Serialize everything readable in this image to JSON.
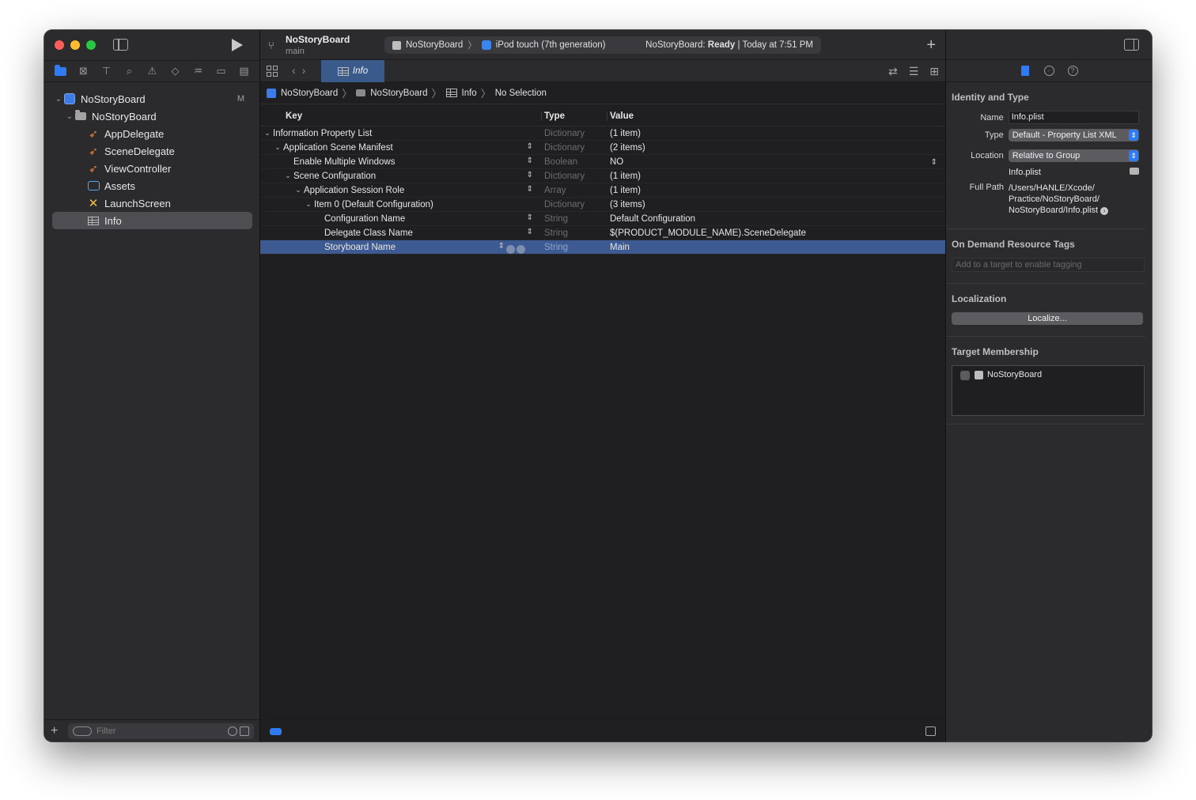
{
  "navigator": {
    "tree": [
      {
        "label": "NoStoryBoard",
        "kind": "project",
        "badge": "M"
      },
      {
        "label": "NoStoryBoard",
        "kind": "group"
      },
      {
        "label": "AppDelegate",
        "kind": "swift"
      },
      {
        "label": "SceneDelegate",
        "kind": "swift"
      },
      {
        "label": "ViewController",
        "kind": "swift"
      },
      {
        "label": "Assets",
        "kind": "assets"
      },
      {
        "label": "LaunchScreen",
        "kind": "storyboard"
      },
      {
        "label": "Info",
        "kind": "plist",
        "selected": true
      }
    ],
    "filter_placeholder": "Filter"
  },
  "toolbar": {
    "project": "NoStoryBoard",
    "branch": "main",
    "scheme": "NoStoryBoard",
    "device": "iPod touch (7th generation)",
    "status_prefix": "NoStoryBoard: ",
    "status_bold": "Ready",
    "status_suffix": " | Today at 7:51 PM"
  },
  "tab": {
    "label": "Info"
  },
  "jumpbar": {
    "items": [
      "NoStoryBoard",
      "NoStoryBoard",
      "Info",
      "No Selection"
    ]
  },
  "plist": {
    "headers": {
      "key": "Key",
      "type": "Type",
      "value": "Value"
    },
    "rows": [
      {
        "key": "Information Property List",
        "type": "Dictionary",
        "value": "(1 item)",
        "depth": 0,
        "expanded": true
      },
      {
        "key": "Application Scene Manifest",
        "type": "Dictionary",
        "value": "(2 items)",
        "depth": 1,
        "expanded": true
      },
      {
        "key": "Enable Multiple Windows",
        "type": "Boolean",
        "value": "NO",
        "depth": 2
      },
      {
        "key": "Scene Configuration",
        "type": "Dictionary",
        "value": "(1 item)",
        "depth": 2,
        "expanded": true
      },
      {
        "key": "Application Session Role",
        "type": "Array",
        "value": "(1 item)",
        "depth": 3,
        "expanded": true
      },
      {
        "key": "Item 0 (Default Configuration)",
        "type": "Dictionary",
        "value": "(3 items)",
        "depth": 4,
        "expanded": true
      },
      {
        "key": "Configuration Name",
        "type": "String",
        "value": "Default Configuration",
        "depth": 5
      },
      {
        "key": "Delegate Class Name",
        "type": "String",
        "value": "$(PRODUCT_MODULE_NAME).SceneDelegate",
        "depth": 5
      },
      {
        "key": "Storyboard Name",
        "type": "String",
        "value": "Main",
        "depth": 5,
        "selected": true
      }
    ]
  },
  "inspector": {
    "identity": {
      "title": "Identity and Type",
      "name_label": "Name",
      "name_value": "Info.plist",
      "type_label": "Type",
      "type_value": "Default - Property List XML",
      "location_label": "Location",
      "location_value": "Relative to Group",
      "location_file": "Info.plist",
      "fullpath_label": "Full Path",
      "fullpath_line1": "/Users/HANLE/Xcode/",
      "fullpath_line2": "Practice/NoStoryBoard/",
      "fullpath_line3": "NoStoryBoard/Info.plist"
    },
    "ondemand": {
      "title": "On Demand Resource Tags",
      "placeholder": "Add to a target to enable tagging"
    },
    "localization": {
      "title": "Localization",
      "button": "Localize..."
    },
    "membership": {
      "title": "Target Membership",
      "target": "NoStoryBoard"
    }
  },
  "colors": {
    "accent": "#2f7bf5",
    "selection": "#3d5a92",
    "window_bg": "#1f1f22",
    "panel_bg": "#2b2b2e"
  }
}
